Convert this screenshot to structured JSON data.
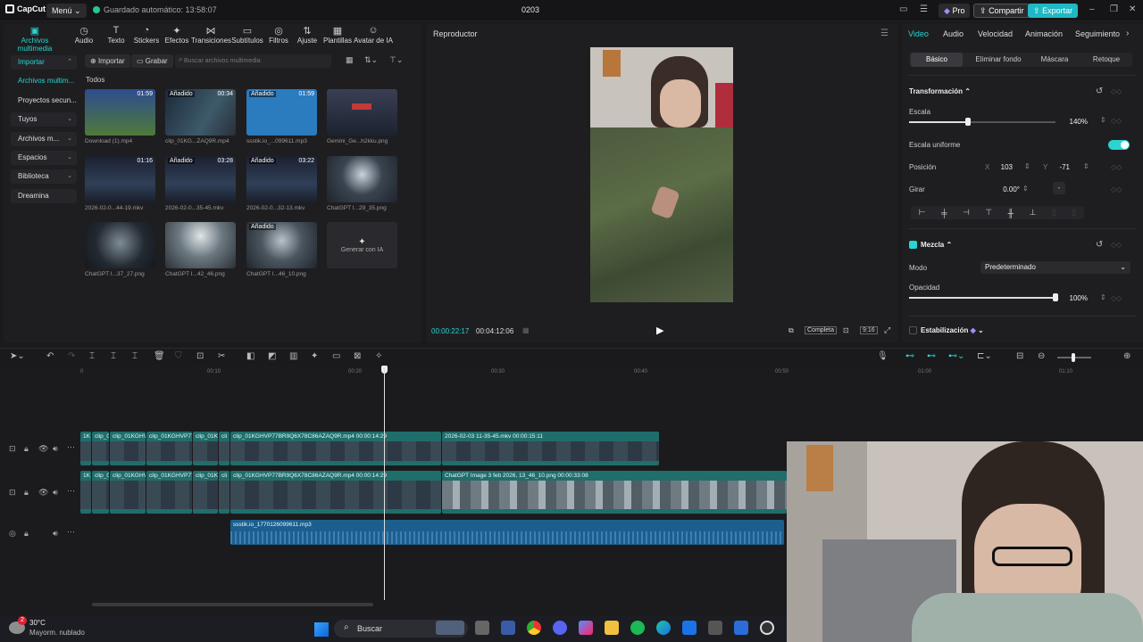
{
  "topbar": {
    "logo": "CapCut",
    "menu": "Menú",
    "autosave": "Guardado automático: 13:58:07",
    "project_title": "0203",
    "pro": "Pro",
    "share": "Compartir",
    "export": "Exportar"
  },
  "media_tabs": [
    {
      "label": "Archivos multimedia",
      "icon": "media-icon"
    },
    {
      "label": "Audio",
      "icon": "audio-icon"
    },
    {
      "label": "Texto",
      "icon": "text-icon"
    },
    {
      "label": "Stickers",
      "icon": "sticker-icon"
    },
    {
      "label": "Efectos",
      "icon": "effects-icon"
    },
    {
      "label": "Transiciones",
      "icon": "transition-icon"
    },
    {
      "label": "Subtítulos",
      "icon": "subtitle-icon"
    },
    {
      "label": "Filtros",
      "icon": "filter-icon"
    },
    {
      "label": "Ajuste",
      "icon": "adjust-icon"
    },
    {
      "label": "Plantillas",
      "icon": "template-icon"
    },
    {
      "label": "Avatar de IA",
      "icon": "avatar-icon"
    }
  ],
  "media_sidebar": [
    {
      "label": "Importar"
    },
    {
      "label": "Archivos multim..."
    },
    {
      "label": "Proyectos secun..."
    },
    {
      "label": "Tuyos"
    },
    {
      "label": "Archivos m..."
    },
    {
      "label": "Espacios"
    },
    {
      "label": "Biblioteca"
    },
    {
      "label": "Dreamina"
    }
  ],
  "media_toolbar": {
    "import": "Importar",
    "record": "Grabar",
    "search_placeholder": "Buscar archivos multimedia",
    "section": "Todos"
  },
  "media_items": [
    {
      "name": "Download (1).mp4",
      "duration": "01:59",
      "added": ""
    },
    {
      "name": "clip_01KG...ZAQ9R.mp4",
      "duration": "00:34",
      "added": "Añadido"
    },
    {
      "name": "ssstik.io_...099611.mp3",
      "duration": "01:59",
      "added": "Añadido"
    },
    {
      "name": "Gemini_Ge...h2kku.png",
      "duration": "",
      "added": ""
    },
    {
      "name": "2026-02-0...44-19.mkv",
      "duration": "01:16",
      "added": ""
    },
    {
      "name": "2026-02-0...35-45.mkv",
      "duration": "03:28",
      "added": "Añadido"
    },
    {
      "name": "2026-02-0...32-13.mkv",
      "duration": "03:22",
      "added": "Añadido"
    },
    {
      "name": "ChatGPT I...29_35.png",
      "duration": "",
      "added": ""
    },
    {
      "name": "ChatGPT I...37_27.png",
      "duration": "",
      "added": ""
    },
    {
      "name": "ChatGPT I...42_46.png",
      "duration": "",
      "added": ""
    },
    {
      "name": "ChatGPT I...46_10.png",
      "duration": "",
      "added": "Añadido"
    }
  ],
  "generate_ai": "Generar con IA",
  "player": {
    "title": "Reproductor",
    "current_time": "00:00:22:17",
    "total_time": "00:04:12:06",
    "full": "Completa",
    "ratio": "9:16"
  },
  "props": {
    "tabs": [
      "Video",
      "Audio",
      "Velocidad",
      "Animación",
      "Seguimiento"
    ],
    "subtabs": [
      "Básico",
      "Eliminar fondo",
      "Máscara",
      "Retoque"
    ],
    "transform": "Transformación",
    "scale_label": "Escala",
    "scale_value": "140%",
    "scale_fraction": 0.4,
    "uniform_label": "Escala uniforme",
    "position_label": "Posición",
    "x_label": "X",
    "x_value": "103",
    "y_label": "Y",
    "y_value": "-71",
    "rotate_label": "Girar",
    "rotate_value": "0.00°",
    "rotate_dash": "-",
    "blend": "Mezcla",
    "mode_label": "Modo",
    "mode_value": "Predeterminado",
    "opacity_label": "Opacidad",
    "opacity_value": "100%",
    "opacity_fraction": 1.0,
    "stabilization": "Estabilización"
  },
  "ruler": [
    "0",
    "00:10",
    "00:20",
    "00:30",
    "00:40",
    "00:50",
    "01:00",
    "01:10"
  ],
  "tracks": {
    "track1_clips": [
      {
        "label": "1K"
      },
      {
        "label": "clip_0"
      },
      {
        "label": "clip_01KGHV"
      },
      {
        "label": "clip_01KGHVP77"
      },
      {
        "label": "clip_01KI"
      },
      {
        "label": "cli"
      },
      {
        "label": "clip_01KGHVP77BR9Q6X78C86AZAQ9R.mp4  00:00:14:29"
      },
      {
        "label": "2026-02-03 11-35-45.mkv  00:00:15:11"
      }
    ],
    "track2_clips": [
      {
        "label": "1K"
      },
      {
        "label": "clip_0"
      },
      {
        "label": "clip_01KGHV"
      },
      {
        "label": "clip_01KGHVP77"
      },
      {
        "label": "clip_01KI"
      },
      {
        "label": "cli"
      },
      {
        "label": "clip_01KGHVP77BR9Q6X78C86AZAQ9R.mp4  00:00:14:29"
      },
      {
        "label": "ChatGPT Image 3 feb 2026, 13_46_10.png  00:00:33:08"
      }
    ],
    "audio_clip": "ssstik.io_1770126099611.mp3"
  },
  "taskbar": {
    "temp": "30°C",
    "weather": "Mayorm. nublado",
    "search": "Buscar",
    "notif": "2"
  }
}
